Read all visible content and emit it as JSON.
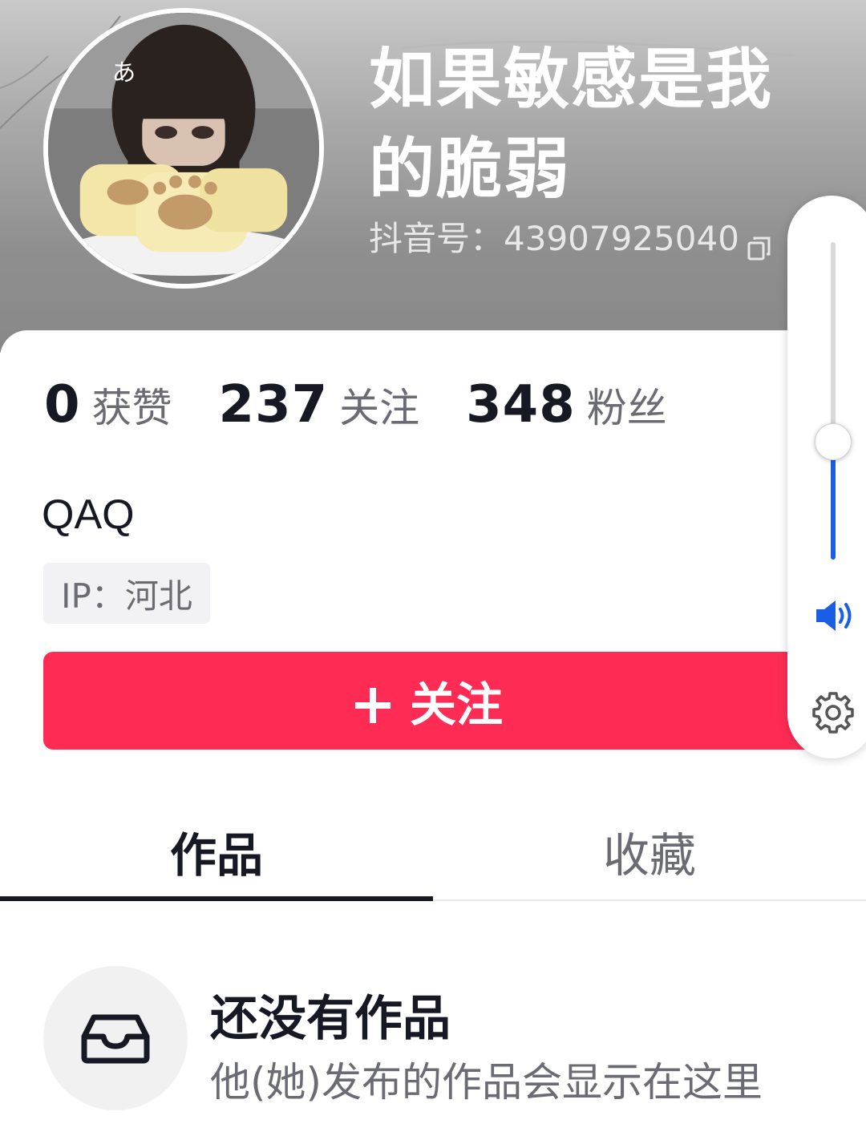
{
  "profile": {
    "nickname": "如果敏感是我的脆弱",
    "douyin_id": "抖音号：43907925040",
    "bio": "QAQ",
    "ip_label": "IP：河北"
  },
  "stats": [
    {
      "value": "0",
      "label": "获赞"
    },
    {
      "value": "237",
      "label": "关注"
    },
    {
      "value": "348",
      "label": "粉丝"
    }
  ],
  "follow_button": {
    "label": "关注"
  },
  "tabs": [
    {
      "label": "作品",
      "active": true
    },
    {
      "label": "收藏",
      "active": false
    }
  ],
  "empty_state": {
    "title": "还没有作品",
    "subtitle": "他(她)发布的作品会显示在这里",
    "icon": "inbox-icon"
  },
  "volume": {
    "level": 0.37,
    "icons": [
      "speaker-icon",
      "gear-icon"
    ]
  },
  "colors": {
    "accent": "#fe2c55",
    "volume_fill": "#1b5ee6",
    "text_primary": "#161823",
    "text_secondary": "#6b6b73"
  }
}
